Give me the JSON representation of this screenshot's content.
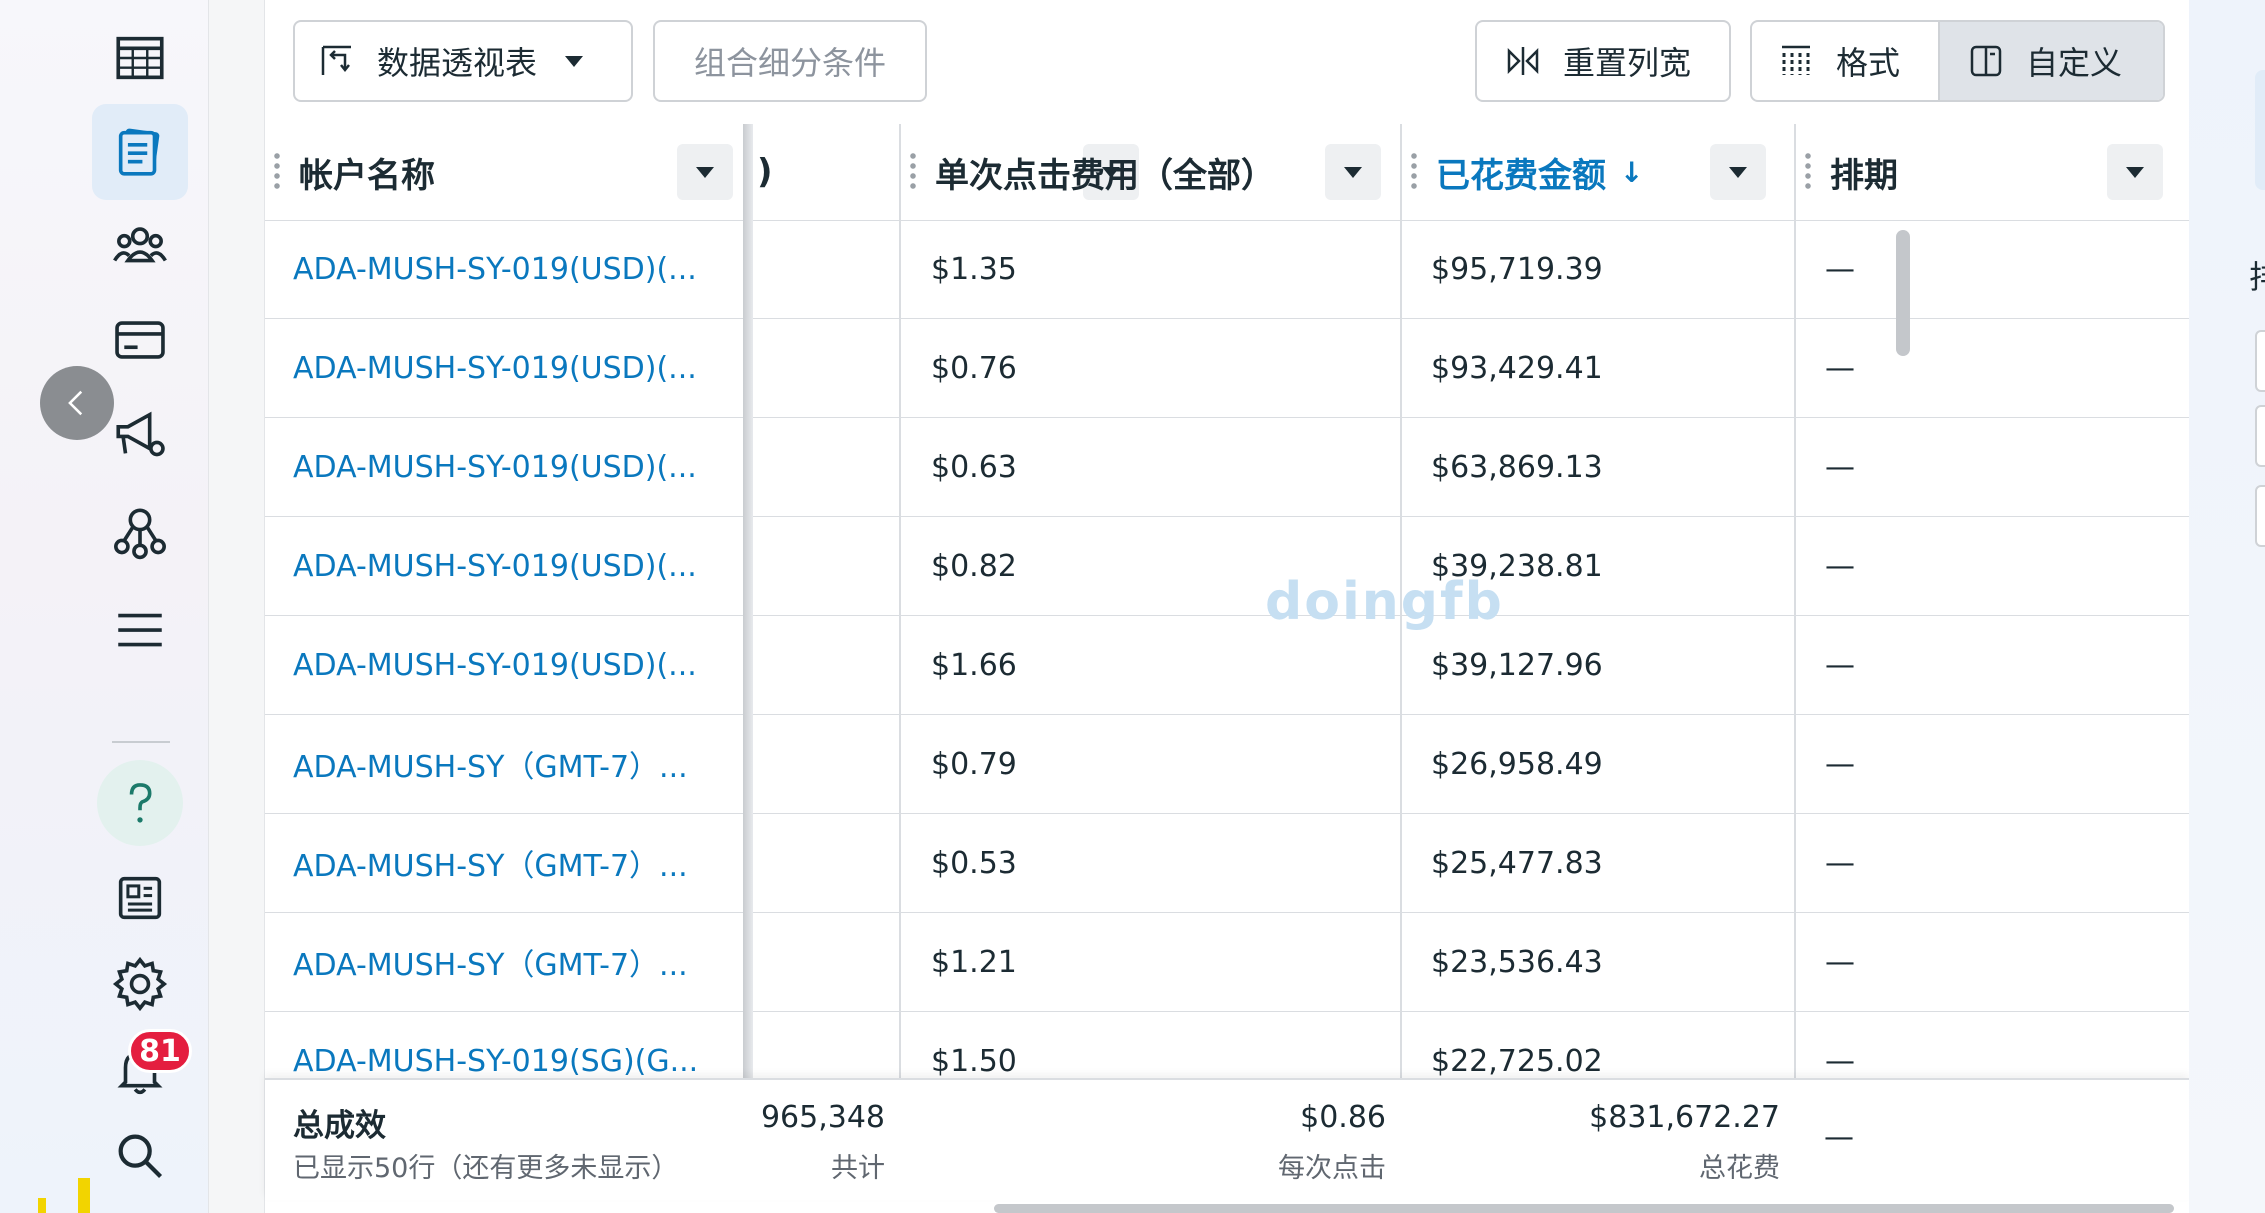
{
  "toolbar": {
    "pivot_label": "数据透视表",
    "breakdown_label": "组合细分条件",
    "reset_columns_label": "重置列宽",
    "format_label": "格式",
    "customize_label": "自定义"
  },
  "columns": {
    "account_name": "帐户名称",
    "partial": ")",
    "cpc": "单次点击费用（全部）",
    "spend": "已花费金额",
    "spend_sort": "↓",
    "schedule": "排期"
  },
  "rows": [
    {
      "name": "ADA-MUSH-SY-019(USD)(...",
      "cpc": "$1.35",
      "spend": "$95,719.39",
      "schedule": "—"
    },
    {
      "name": "ADA-MUSH-SY-019(USD)(...",
      "cpc": "$0.76",
      "spend": "$93,429.41",
      "schedule": "—"
    },
    {
      "name": "ADA-MUSH-SY-019(USD)(...",
      "cpc": "$0.63",
      "spend": "$63,869.13",
      "schedule": "—"
    },
    {
      "name": "ADA-MUSH-SY-019(USD)(...",
      "cpc": "$0.82",
      "spend": "$39,238.81",
      "schedule": "—"
    },
    {
      "name": "ADA-MUSH-SY-019(USD)(...",
      "cpc": "$1.66",
      "spend": "$39,127.96",
      "schedule": "—"
    },
    {
      "name": "ADA-MUSH-SY（GMT-7）...",
      "cpc": "$0.79",
      "spend": "$26,958.49",
      "schedule": "—"
    },
    {
      "name": "ADA-MUSH-SY（GMT-7）...",
      "cpc": "$0.53",
      "spend": "$25,477.83",
      "schedule": "—"
    },
    {
      "name": "ADA-MUSH-SY（GMT-7）...",
      "cpc": "$1.21",
      "spend": "$23,536.43",
      "schedule": "—"
    },
    {
      "name": "ADA-MUSH-SY-019(SG)(G...",
      "cpc": "$1.50",
      "spend": "$22,725.02",
      "schedule": "—"
    }
  ],
  "footer": {
    "title": "总成效",
    "subtitle": "已显示50行（还有更多未显示）",
    "partial_value": "965,348",
    "partial_sub": "共计",
    "cpc_value": "$0.86",
    "cpc_sub": "每次点击",
    "spend_value": "$831,672.27",
    "spend_sub": "总花费",
    "schedule_value": "—"
  },
  "notifications": {
    "count": "81"
  },
  "watermark": "doingfb",
  "right_panel": {
    "partial_char": "排"
  },
  "colors": {
    "link": "#0a78be",
    "badge": "#e41e3f",
    "active_nav": "#e1ecf8"
  }
}
